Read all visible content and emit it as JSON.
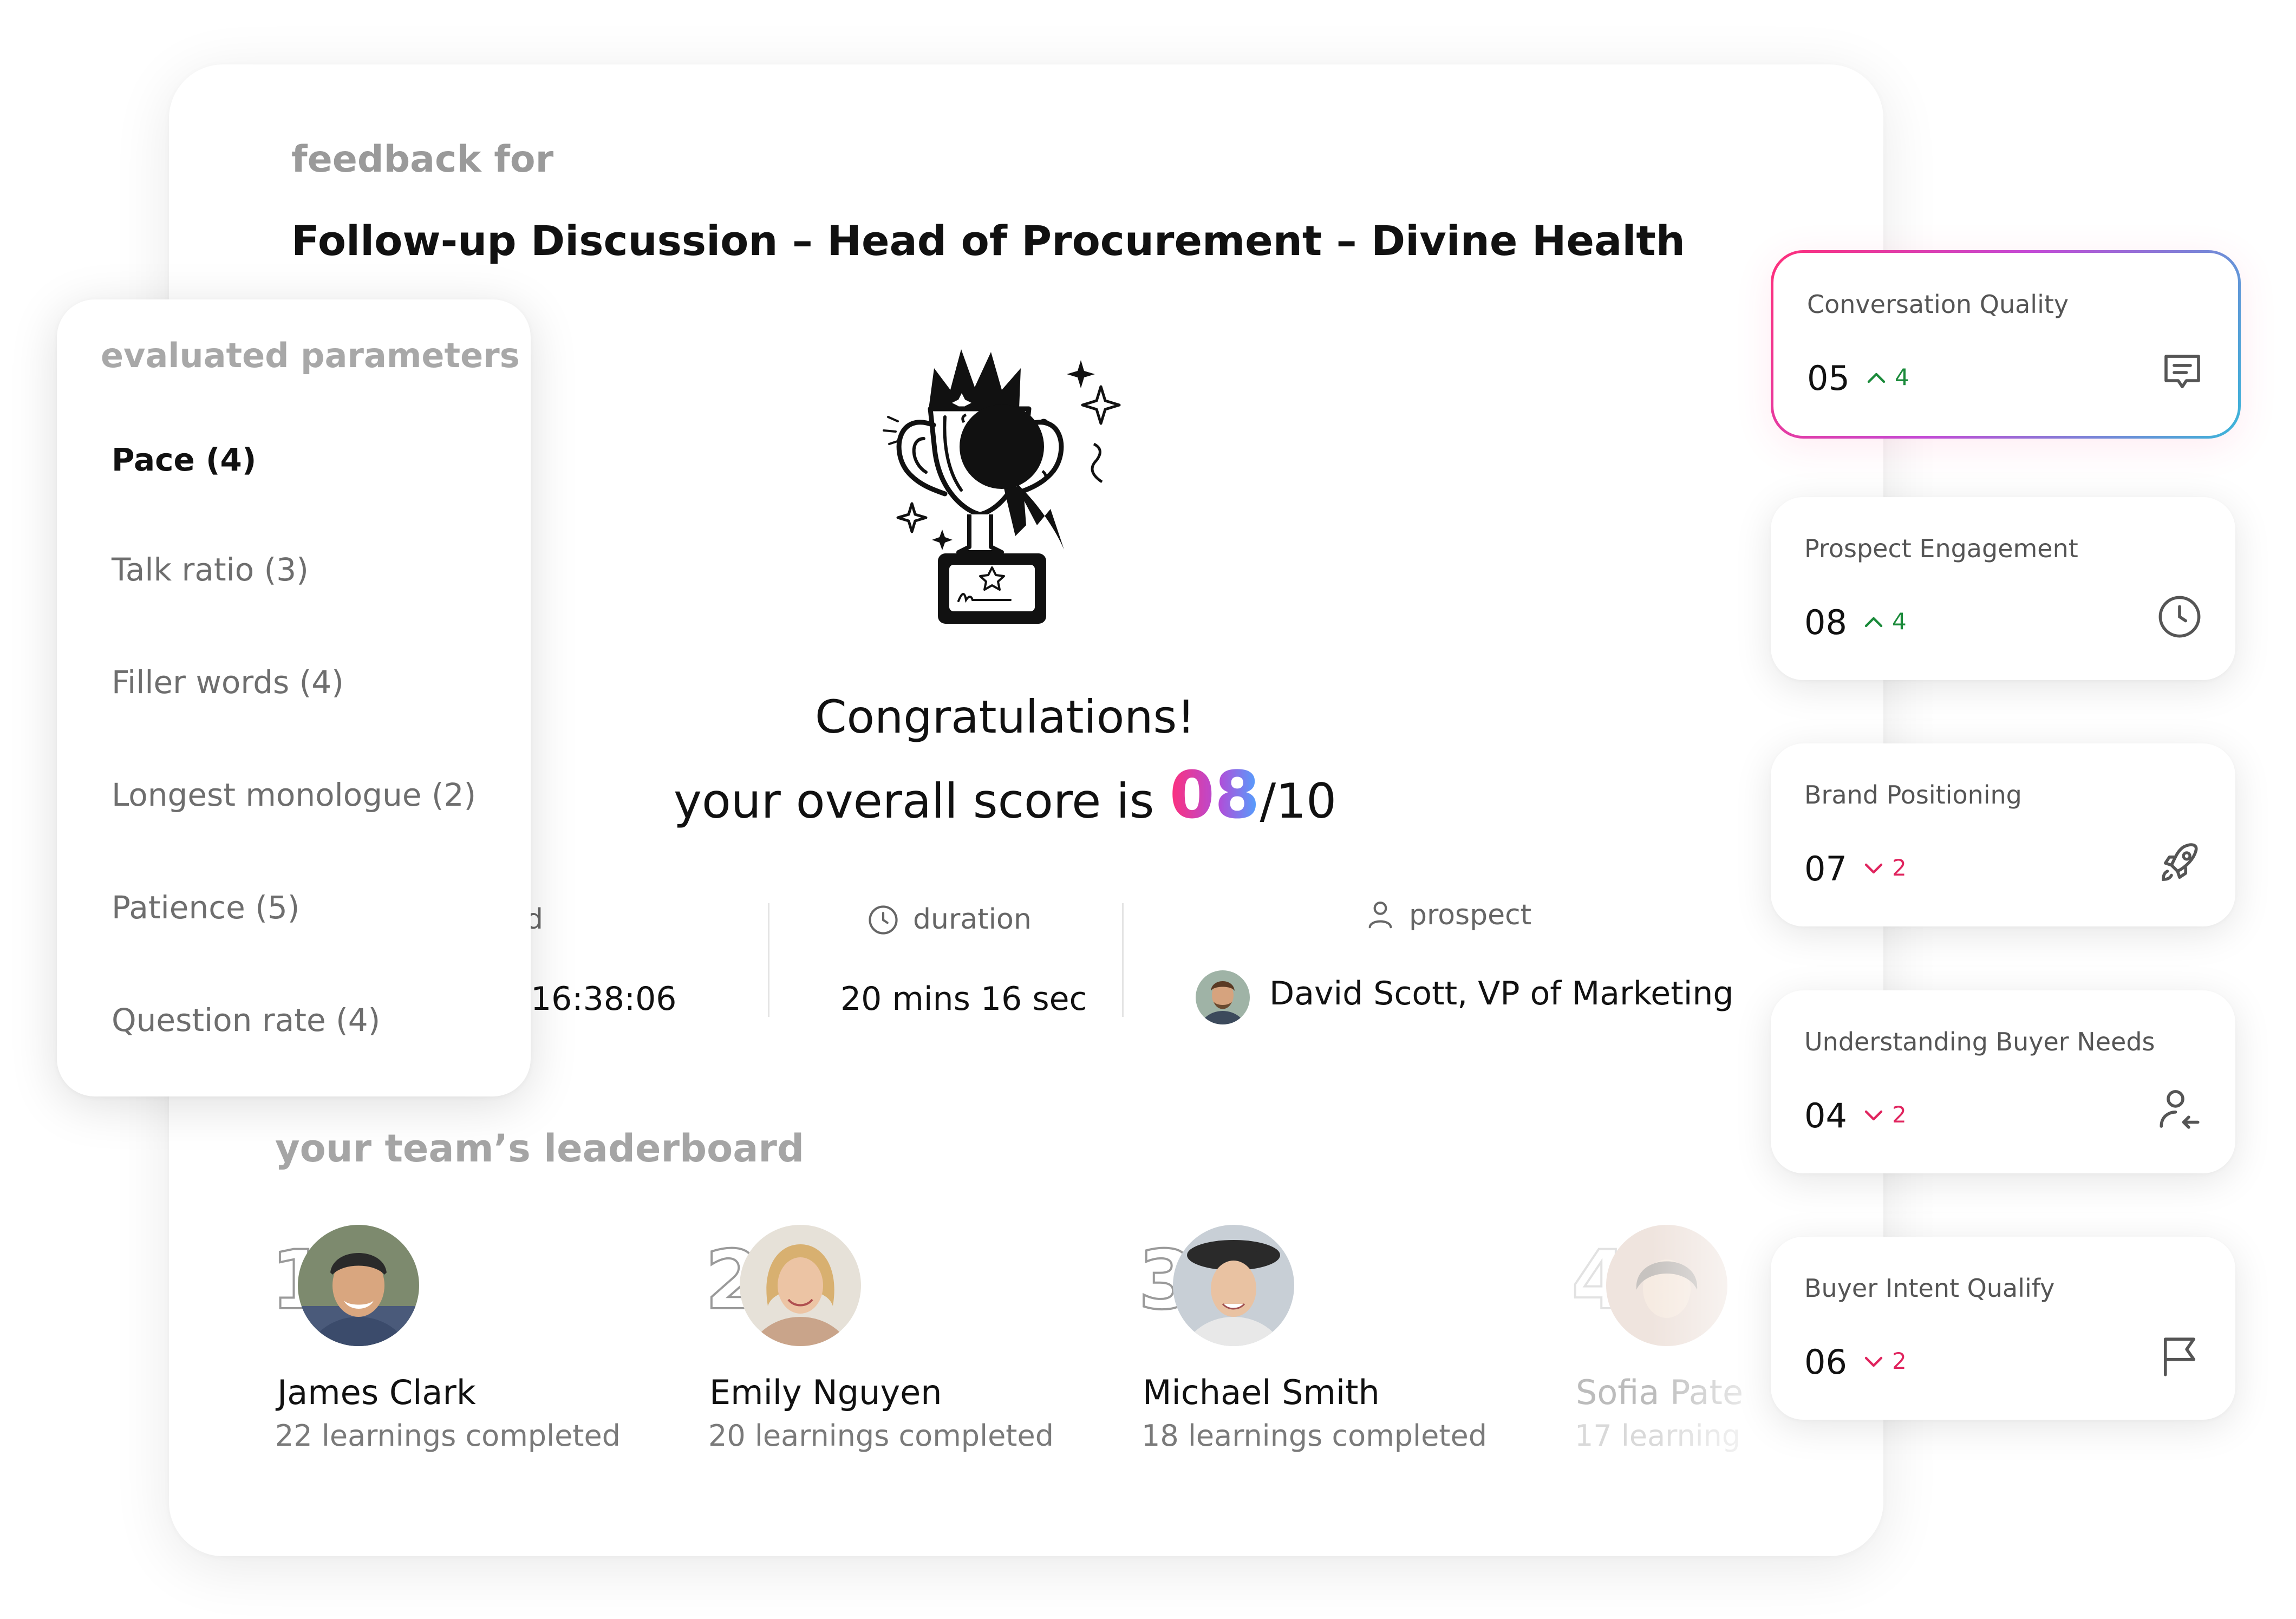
{
  "header": {
    "feedback_label": "feedback for",
    "title": "Follow-up Discussion – Head of Procurement – Divine Health"
  },
  "result": {
    "congrats": "Congratulations!",
    "score_prefix": "your overall score is",
    "score_value": "08",
    "score_max": "/10"
  },
  "meta": {
    "logged_label": "ged",
    "logged_value": "16:38:06",
    "duration_label": "duration",
    "duration_value": "20 mins 16 sec",
    "prospect_label": "prospect",
    "prospect_value": "David Scott, VP of Marketing"
  },
  "leaderboard": {
    "title": "your team’s leaderboard",
    "entries": [
      {
        "rank": "1",
        "name": "James Clark",
        "sub": "22 learnings completed"
      },
      {
        "rank": "2",
        "name": "Emily Nguyen",
        "sub": "20 learnings completed"
      },
      {
        "rank": "3",
        "name": "Michael Smith",
        "sub": "18 learnings completed"
      },
      {
        "rank": "4",
        "name": "Sofia Pate",
        "sub": "17 learning"
      }
    ]
  },
  "parameters": {
    "title": "evaluated parameters",
    "items": [
      "Pace (4)",
      "Talk ratio (3)",
      "Filler words (4)",
      "Longest monologue (2)",
      "Patience (5)",
      "Question rate (4)"
    ],
    "active_index": 0
  },
  "metrics": [
    {
      "label": "Conversation Quality",
      "value": "05",
      "direction": "up",
      "change": "4",
      "icon": "chat-icon"
    },
    {
      "label": "Prospect Engagement",
      "value": "08",
      "direction": "up",
      "change": "4",
      "icon": "clock-icon"
    },
    {
      "label": "Brand Positioning",
      "value": "07",
      "direction": "down",
      "change": "2",
      "icon": "rocket-icon"
    },
    {
      "label": "Understanding Buyer Needs",
      "value": "04",
      "direction": "down",
      "change": "2",
      "icon": "user-arrow-icon"
    },
    {
      "label": "Buyer Intent Qualify",
      "value": "06",
      "direction": "down",
      "change": "2",
      "icon": "flag-icon"
    }
  ],
  "colors": {
    "up": "#1a8a3a",
    "down": "#e0245e",
    "score_gradient_start": "#ff2f7a",
    "score_gradient_end": "#4ea4ff"
  }
}
